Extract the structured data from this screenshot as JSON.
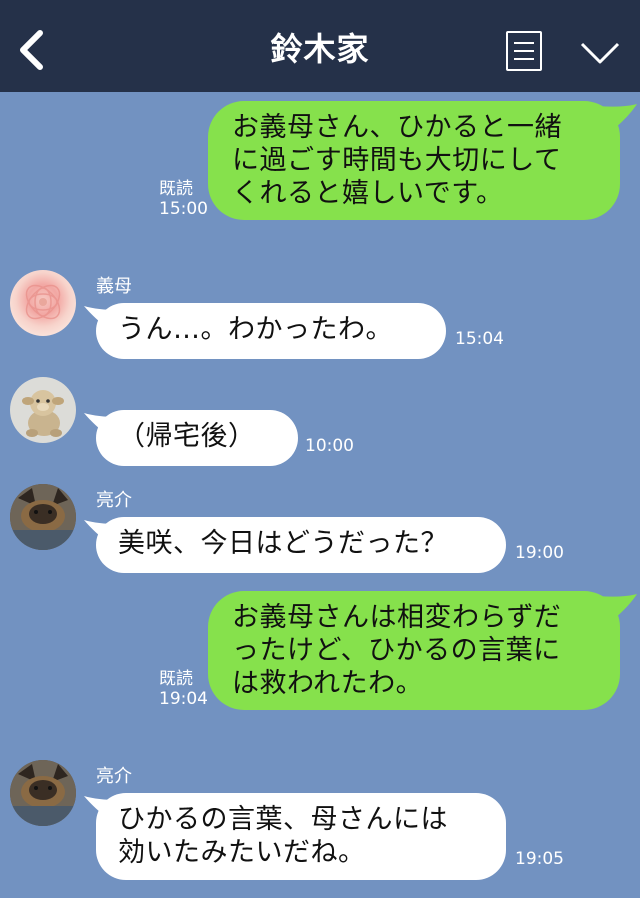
{
  "header": {
    "title": "鈴木家"
  },
  "icons": {
    "back": "chevron-left-icon",
    "menu": "menu-list-icon",
    "dropdown": "chevron-down-icon"
  },
  "colors": {
    "header_bg": "#253149",
    "chat_bg": "#7292c1",
    "outgoing_bubble": "#86e14c",
    "incoming_bubble": "#ffffff"
  },
  "messages": [
    {
      "side": "outgoing",
      "lines": [
        "お義母さん、ひかると一緒",
        "に過ごす時間も大切にして",
        "くれると嬉しいです。"
      ],
      "read": "既読",
      "time": "15:00"
    },
    {
      "side": "incoming",
      "sender": "義母",
      "avatar": "flower-avatar",
      "lines": [
        "うん…。わかったわ。"
      ],
      "time": "15:04"
    },
    {
      "side": "incoming",
      "sender": "",
      "avatar": "sheep-plush-avatar",
      "lines": [
        "（帰宅後）"
      ],
      "time": "10:00"
    },
    {
      "side": "incoming",
      "sender": "亮介",
      "avatar": "dog-avatar",
      "lines": [
        "美咲、今日はどうだった？"
      ],
      "time": "19:00"
    },
    {
      "side": "outgoing",
      "lines": [
        "お義母さんは相変わらずだ",
        "ったけど、ひかるの言葉に",
        "は救われたわ。"
      ],
      "read": "既読",
      "time": "19:04"
    },
    {
      "side": "incoming",
      "sender": "亮介",
      "avatar": "dog-avatar",
      "lines": [
        "ひかるの言葉、母さんには",
        "効いたみたいだね。"
      ],
      "time": "19:05"
    }
  ]
}
